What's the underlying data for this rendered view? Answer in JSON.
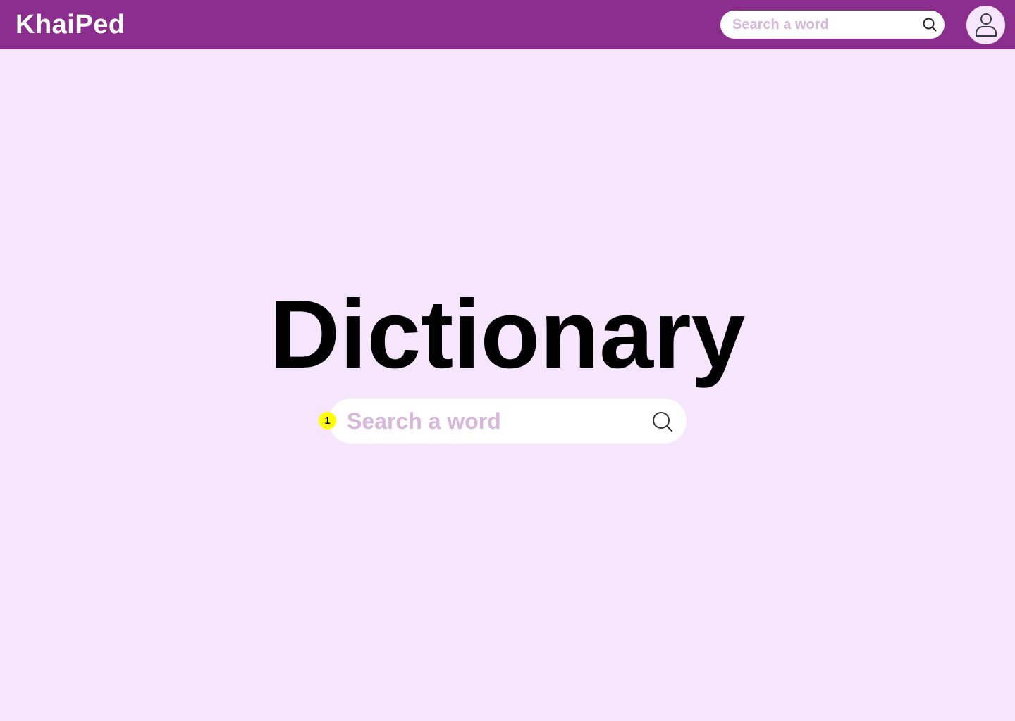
{
  "header": {
    "logo_text": "KhaiPed",
    "search": {
      "placeholder": "Search a word",
      "icon": "search-icon"
    },
    "avatar_icon": "user-icon"
  },
  "main": {
    "title": "Dictionary",
    "search": {
      "placeholder": "Search a word",
      "icon": "search-icon"
    },
    "marker_label": "1"
  },
  "colors": {
    "header_bg": "#8a2d8c",
    "page_bg": "#f5e6fd",
    "placeholder": "#d6b6d9",
    "marker": "#ffff00"
  }
}
